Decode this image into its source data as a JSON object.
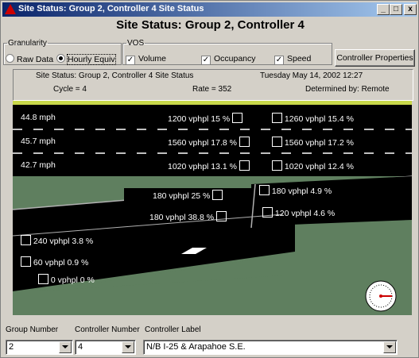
{
  "window": {
    "title": "Site Status: Group 2, Controller 4 Site Status",
    "minimize": "_",
    "maximize": "□",
    "close": "x"
  },
  "heading": "Site Status: Group 2, Controller 4",
  "granularity": {
    "legend": "Granularity",
    "options": [
      "Raw Data",
      "Hourly Equiv"
    ],
    "selected": "Hourly Equiv"
  },
  "vos": {
    "legend": "VOS",
    "checks": [
      {
        "label": "Volume",
        "checked": true
      },
      {
        "label": "Occupancy",
        "checked": true
      },
      {
        "label": "Speed",
        "checked": true
      }
    ]
  },
  "controller_properties_label": "Controller Properties",
  "status": {
    "site": "Site Status: Group 2, Controller 4 Site Status",
    "datetime": "Tuesday May 14, 2002  12:27",
    "cycle": "Cycle = 4",
    "rate": "Rate = 352",
    "determined": "Determined by: Remote"
  },
  "mainline": [
    {
      "speed": "44.8 mph",
      "left": "1200 vphpl  15 %",
      "right": "1260 vphpl  15.4 %"
    },
    {
      "speed": "45.7 mph",
      "left": "1560 vphpl  17.8 %",
      "right": "1560 vphpl  17.2 %"
    },
    {
      "speed": "42.7 mph",
      "left": "1020 vphpl  13.1 %",
      "right": "1020 vphpl  12.4 %"
    }
  ],
  "ramp_upper": [
    {
      "text": "180 vphpl  25 %"
    },
    {
      "text": "180 vphpl  38.8 %"
    },
    {
      "text": "180 vphpl  4.9 %"
    },
    {
      "text": "120 vphpl  4.6 %"
    }
  ],
  "ramp_lower": [
    {
      "text": "240 vphpl  3.8 %"
    },
    {
      "text": "60 vphpl  0.9 %"
    },
    {
      "text": "0 vphpl  0 %"
    }
  ],
  "bottom": {
    "group_label": "Group Number",
    "controller_label": "Controller Number",
    "label_label": "Controller Label",
    "group_value": "2",
    "controller_value": "4",
    "label_value": "N/B I-25 & Arapahoe S.E."
  },
  "colors": {
    "road": "#000000",
    "grass": "#5f7f5f",
    "titlebar": "#0a246a",
    "stopbar": "#c8d84a"
  }
}
